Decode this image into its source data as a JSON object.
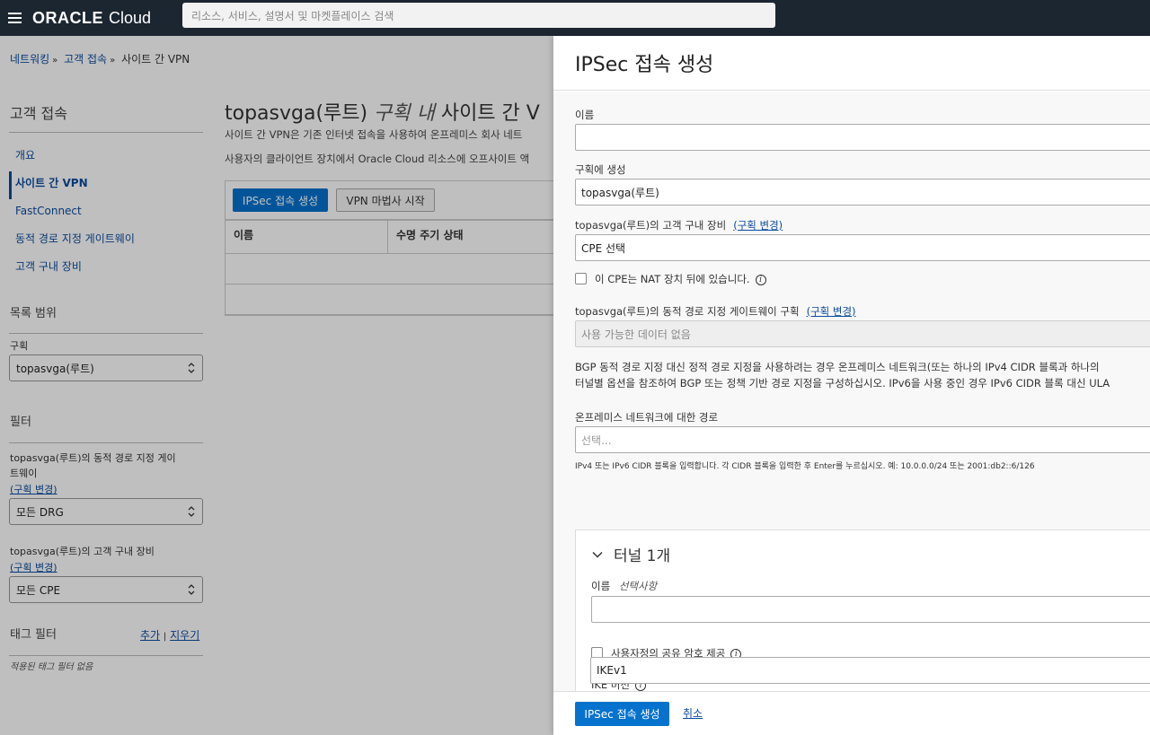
{
  "topbar": {
    "logo_oracle": "ORACLE",
    "logo_cloud": "Cloud",
    "search_placeholder": "리소스, 서비스, 설명서 및 마켓플레이스 검색"
  },
  "breadcrumb": {
    "items": [
      "네트워킹",
      "고객 접속",
      "사이트 간 VPN"
    ],
    "separator": "»"
  },
  "sidebar": {
    "title": "고객 접속",
    "nav": [
      {
        "label": "개요"
      },
      {
        "label": "사이트 간 VPN",
        "active": true
      },
      {
        "label": "FastConnect"
      },
      {
        "label": "동적 경로 지정 게이트웨이"
      },
      {
        "label": "고객 구내 장비"
      }
    ],
    "scope_title": "목록 범위",
    "compartment_label": "구획",
    "compartment_value": "topasvga(루트)",
    "filter_title": "필터",
    "drg_filter_label_1": "topasvga(루트)의 동적 경로 지정 게이",
    "drg_filter_label_2": "트웨이",
    "drg_filter_link": "(구획 변경)",
    "drg_filter_value": "모든 DRG",
    "cpe_filter_label": "topasvga(루트)의 고객 구내 장비",
    "cpe_filter_link": "(구획 변경)",
    "cpe_filter_value": "모든 CPE",
    "tag_filter_title": "태그 필터",
    "tag_add": "추가",
    "tag_divider": "|",
    "tag_clear": "지우기",
    "tag_empty": "적용된 태그 필터 없음"
  },
  "main": {
    "title_prefix": "topasvga(루트)",
    "title_italic": "구획 내",
    "title_suffix": "사이트 간 V",
    "desc_1": "사이트 간 VPN은 기존 인터넷 접속을 사용하여 온프레미스 회사 네트",
    "desc_2": "사용자의 클라이언트 장치에서 Oracle Cloud 리소스에 오프사이트 액",
    "btn_create": "IPSec 접속 생성",
    "btn_wizard": "VPN 마법사 시작",
    "columns": [
      "이름",
      "수명 주기 상태"
    ]
  },
  "panel": {
    "title": "IPSec 접속 생성",
    "name_label": "이름",
    "name_value": "",
    "compartment_label": "구획에 생성",
    "compartment_value": "topasvga(루트)",
    "cpe_label": "topasvga(루트)의 고객 구내 장비",
    "cpe_link": "(구획 변경)",
    "cpe_value": "CPE 선택",
    "nat_label": "이 CPE는 NAT 장치 뒤에 있습니다.",
    "drg_label": "topasvga(루트)의 동적 경로 지정 게이트웨이 구획",
    "drg_link": "(구획 변경)",
    "drg_value": "사용 가능한 데이터 없음",
    "bgp_text_1": "BGP 동적 경로 지정 대신 정적 경로 지정을 사용하려는 경우 온프레미스 네트워크(또는 하나의 IPv4 CIDR 블록과 하나의",
    "bgp_text_2": "터널별 옵션을 참조하여 BGP 또는 정책 기반 경로 지정을 구성하십시오. IPv6을 사용 중인 경우 IPv6 CIDR 블록 대신 ULA",
    "routes_label": "온프레미스 네트워크에 대한 경로",
    "routes_placeholder": "선택...",
    "routes_hint": "IPv4 또는 IPv6 CIDR 블록을 입력합니다. 각 CIDR 블록을 입력한 후 Enter를 누르십시오. 예: 10.0.0.0/24 또는 2001:db2::6/126",
    "tunnel_title": "터널 1개",
    "tunnel_name_label": "이름",
    "tunnel_name_optional": "선택사항",
    "tunnel_name_value": "",
    "shared_secret_label": "사용자정의 공유 암호 제공",
    "ike_label": "IKE 버전",
    "ike_value": "IKEv1",
    "btn_create": "IPSec 접속 생성",
    "btn_cancel": "취소"
  },
  "colors": {
    "topbar": "#1c2631",
    "primary_button": "#0572ce",
    "link": "#0a4b9e"
  }
}
